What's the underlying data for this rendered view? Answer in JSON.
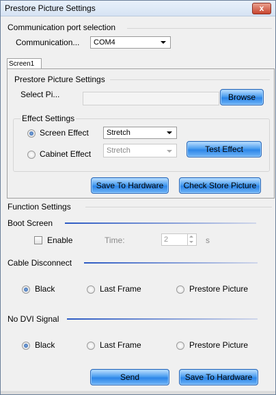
{
  "window": {
    "title": "Prestore Picture Settings",
    "close_label": "x"
  },
  "comm_group": {
    "title": "Communication port selection",
    "label": "Communication...",
    "port_value": "COM4"
  },
  "tabs": [
    {
      "label": "Screen1"
    }
  ],
  "prestore": {
    "title": "Prestore Picture Settings",
    "select_label": "Select Pi...",
    "path_value": "",
    "browse_label": "Browse"
  },
  "effect": {
    "title": "Effect Settings",
    "screen_label": "Screen Effect",
    "screen_value": "Stretch",
    "cabinet_label": "Cabinet Effect",
    "cabinet_value": "Stretch",
    "test_label": "Test Effect",
    "selected": "screen"
  },
  "actions": {
    "save_label": "Save To Hardware",
    "check_label": "Check Store Picture"
  },
  "function": {
    "title": "Function Settings",
    "boot_title": "Boot Screen",
    "enable_label": "Enable",
    "enable_checked": false,
    "time_label": "Time:",
    "time_value": "2",
    "time_unit": "s",
    "cable_title": "Cable Disconnect",
    "cable_options": [
      "Black",
      "Last Frame",
      "Prestore Picture"
    ],
    "cable_selected": "Black",
    "dvi_title": "No DVI Signal",
    "dvi_options": [
      "Black",
      "Last Frame",
      "Prestore Picture"
    ],
    "dvi_selected": "Black",
    "send_label": "Send",
    "save_label": "Save To Hardware"
  },
  "colors": {
    "accent_rule": "#2b59c3",
    "button_blue": "#4d9ff0",
    "close_red": "#c8452f"
  }
}
